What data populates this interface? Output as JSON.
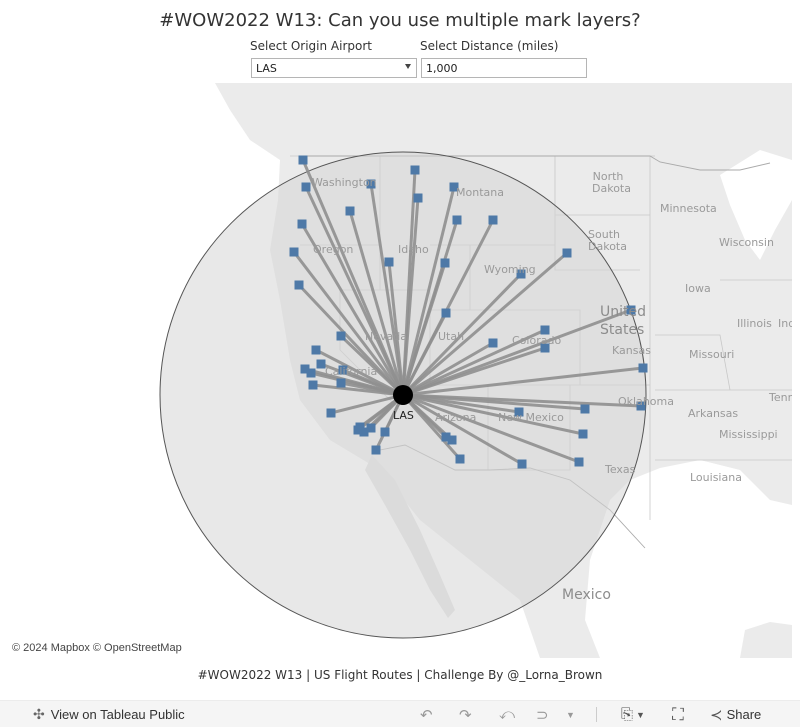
{
  "title": "#WOW2022 W13: Can you use multiple mark layers?",
  "filters": {
    "origin": {
      "label": "Select Origin Airport",
      "value": "LAS",
      "icon": "chevron-down-icon"
    },
    "distance": {
      "label": "Select Distance (miles)",
      "value": "1,000"
    }
  },
  "map": {
    "origin_airport": "LAS",
    "radius_miles": 1000,
    "colors": {
      "ocean": "#ffffff",
      "land": "#ebebeb",
      "radius_fill": "#dcdcdc",
      "radius_stroke": "#555555",
      "route_line": "#8f8f8f",
      "destination_marker": "#4e79a7",
      "origin_marker": "#000000"
    },
    "destination_count": 46,
    "place_labels": [
      "Washington",
      "Oregon",
      "Idaho",
      "Montana",
      "Wyoming",
      "Nevada",
      "Utah",
      "Colorado",
      "California",
      "Arizona",
      "New Mexico",
      "North Dakota",
      "South Dakota",
      "Minnesota",
      "Wisconsin",
      "Iowa",
      "Illinois",
      "Ind",
      "United States",
      "Kansas",
      "Missouri",
      "Oklahoma",
      "Arkansas",
      "Tenn",
      "Mississippi",
      "Texas",
      "Louisiana",
      "Mexico"
    ],
    "attribution": "© 2024 Mapbox  © OpenStreetMap"
  },
  "footer": "#WOW2022 W13 | US Flight Routes | Challenge By @_Lorna_Brown",
  "toolbar": {
    "view_on_public": "View on Tableau Public",
    "undo_icon": "undo-icon",
    "redo_icon": "redo-icon",
    "revert_icon": "revert-icon",
    "refresh_icon": "refresh-icon",
    "download_icon": "download-icon",
    "fullscreen_icon": "fullscreen-icon",
    "share_label": "Share"
  }
}
